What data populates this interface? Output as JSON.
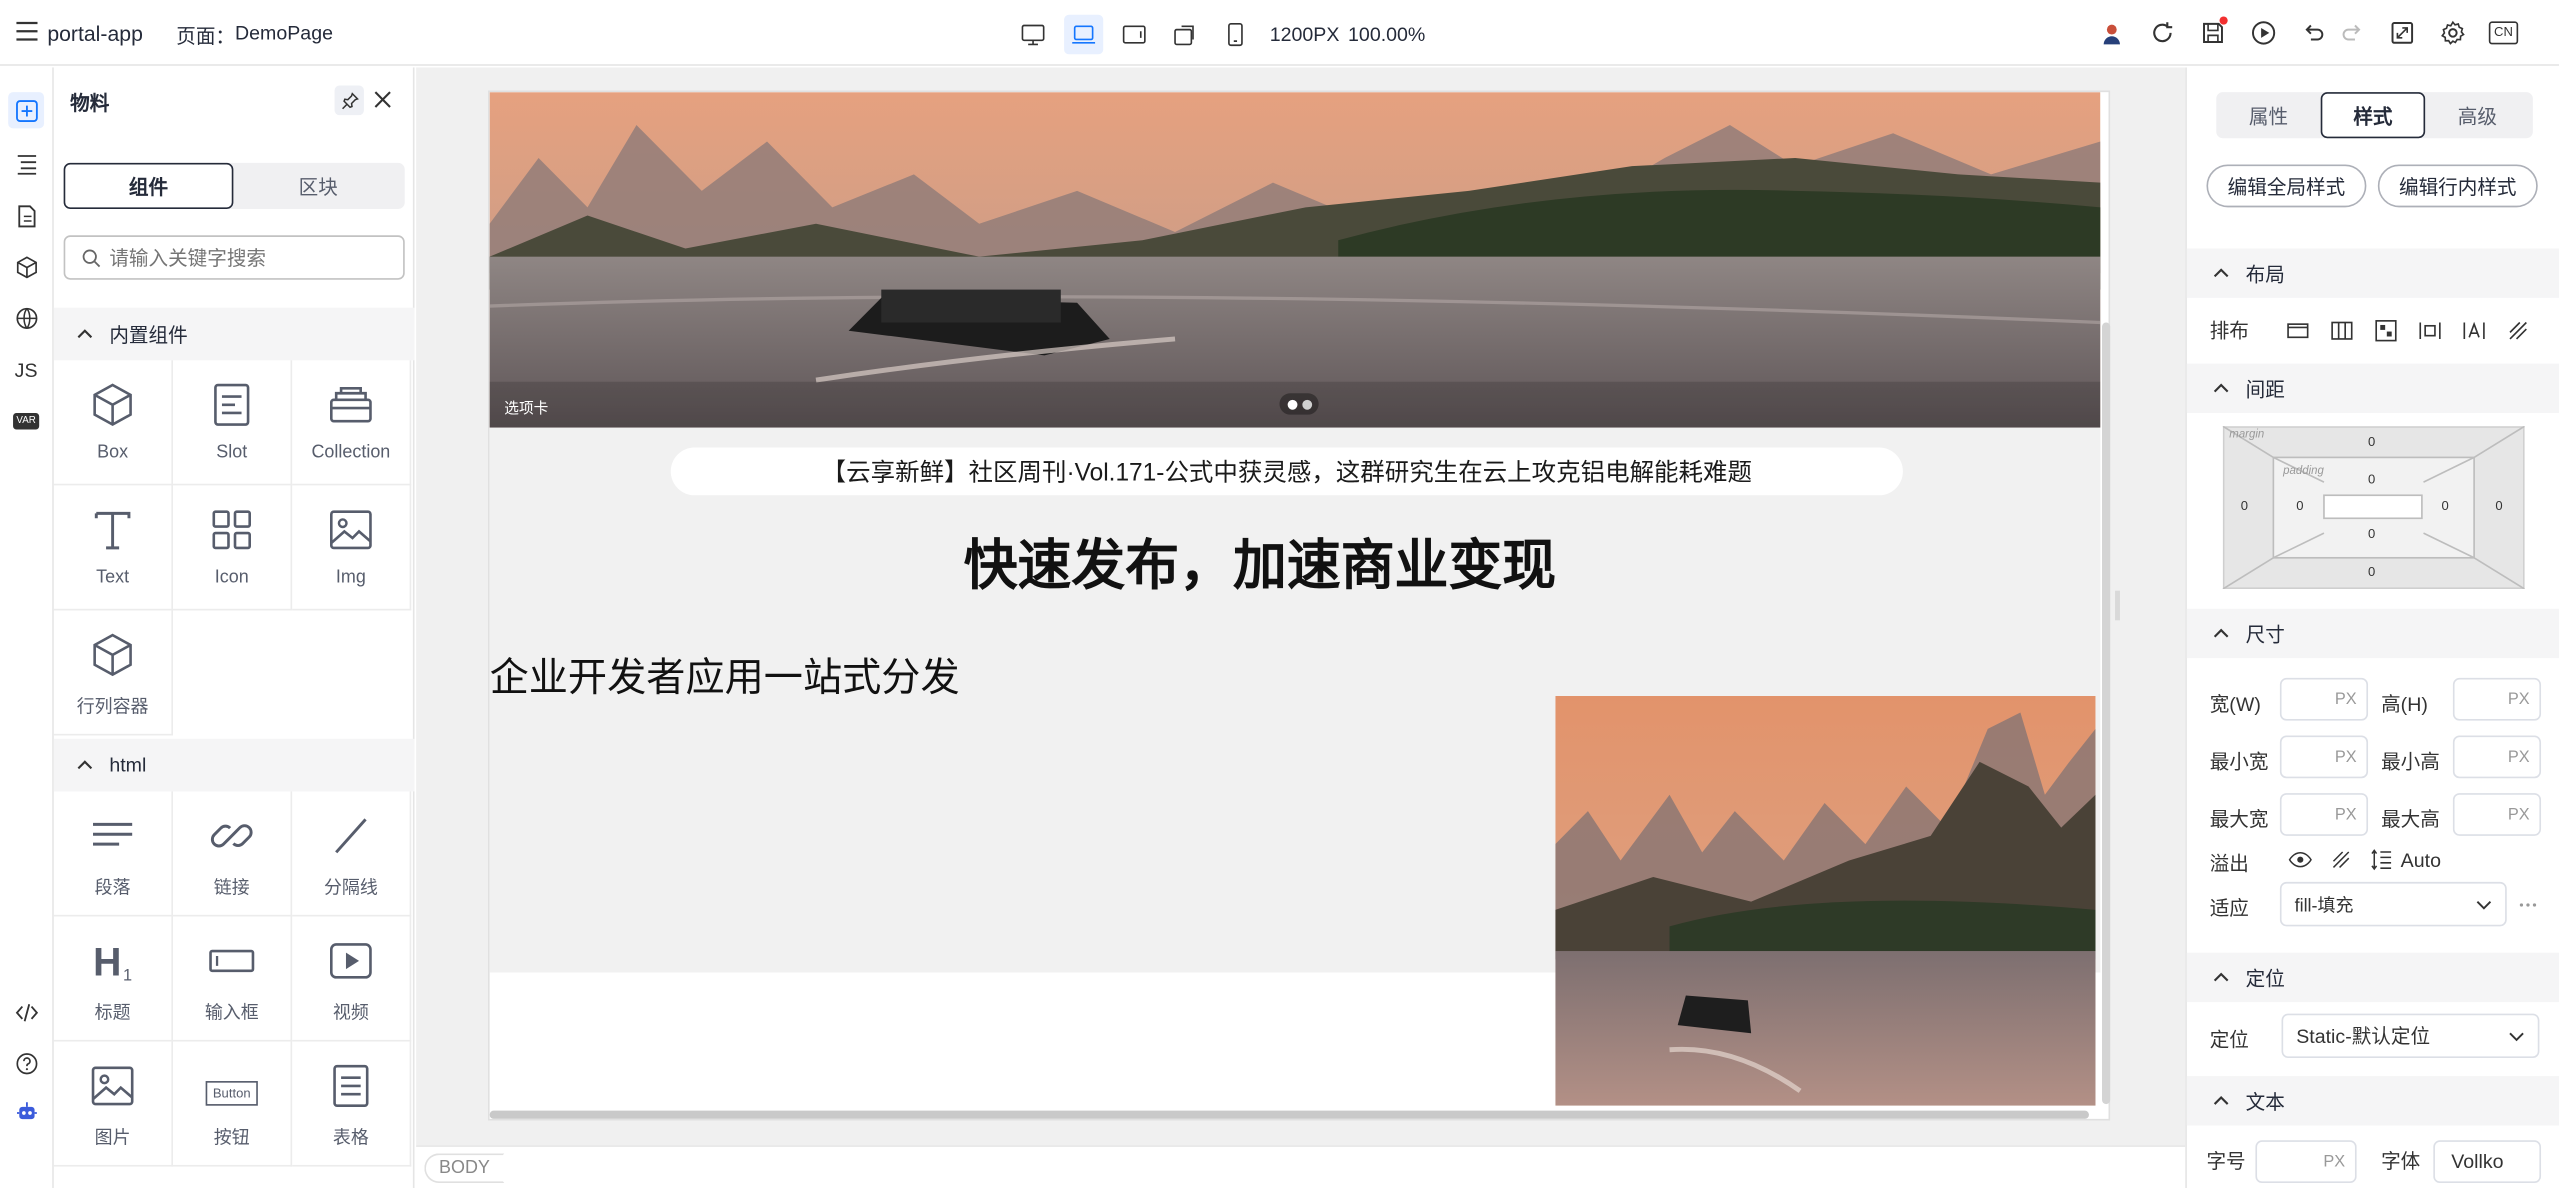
{
  "app": {
    "name": "portal-app",
    "page_label": "页面：",
    "page_name": "DemoPage"
  },
  "toolbar": {
    "width": "1200PX",
    "zoom": "100.00%",
    "lang": "CN"
  },
  "left_panel": {
    "title": "物料",
    "tabs": [
      "组件",
      "区块"
    ],
    "search_placeholder": "请输入关键字搜索",
    "group_builtin": "内置组件",
    "builtin_items": [
      "Box",
      "Slot",
      "Collection",
      "Text",
      "Icon",
      "Img",
      "行列容器"
    ],
    "group_html": "html",
    "html_items": [
      "段落",
      "链接",
      "分隔线",
      "标题",
      "输入框",
      "视频",
      "图片",
      "按钮",
      "表格"
    ],
    "button_icon_text": "Button",
    "h1_icon_text": "H",
    "h1_icon_sub": "1"
  },
  "leftbar": {
    "js": "JS",
    "var": "VAR"
  },
  "canvas": {
    "carousel_label": "选项卡",
    "news_text": "【云享新鲜】社区周刊·Vol.171-公式中获灵感，这群研究生在云上攻克铝电解能耗难题",
    "headline": "快速发布，加速商业变现",
    "subheadline": "企业开发者应用一站式分发",
    "footer_tag": "BODY"
  },
  "right_panel": {
    "tabs": [
      "属性",
      "样式",
      "高级"
    ],
    "active_tab": "样式",
    "buttons": [
      "编辑全局样式",
      "编辑行内样式"
    ],
    "sections": {
      "layout": "布局",
      "spacing": "间距",
      "size": "尺寸",
      "position": "定位",
      "text": "文本"
    },
    "layout_label": "排布",
    "margin_label": "margin",
    "padding_label": "padding",
    "zero": "0",
    "size_labels": [
      "宽(W)",
      "高(H)",
      "最小宽",
      "最小高",
      "最大宽",
      "最大高"
    ],
    "px": "PX",
    "overflow_label": "溢出",
    "overflow_auto": "Auto",
    "fit_label": "适应",
    "fit_value": "fill-填充",
    "position_label": "定位",
    "position_value": "Static-默认定位",
    "font_size_label": "字号",
    "font_family_label": "字体",
    "font_family_value": "Vollko"
  },
  "colors": {
    "accent": "#1476ff",
    "sky": "#e0a584",
    "water": "#7a6f6e"
  }
}
